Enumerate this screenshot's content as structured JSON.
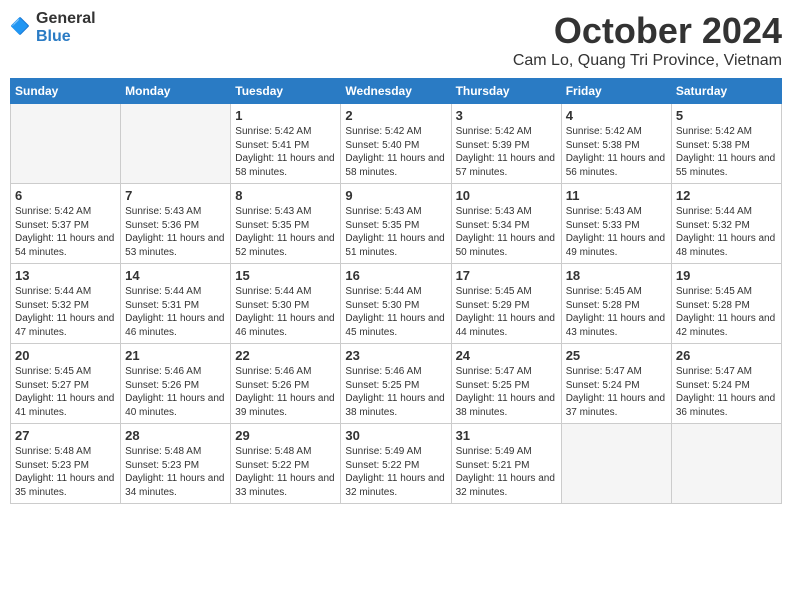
{
  "header": {
    "logo": {
      "general": "General",
      "blue": "Blue"
    },
    "title": "October 2024",
    "location": "Cam Lo, Quang Tri Province, Vietnam"
  },
  "calendar": {
    "days_of_week": [
      "Sunday",
      "Monday",
      "Tuesday",
      "Wednesday",
      "Thursday",
      "Friday",
      "Saturday"
    ],
    "weeks": [
      [
        {
          "day": "",
          "content": ""
        },
        {
          "day": "",
          "content": ""
        },
        {
          "day": "1",
          "content": "Sunrise: 5:42 AM\nSunset: 5:41 PM\nDaylight: 11 hours and 58 minutes."
        },
        {
          "day": "2",
          "content": "Sunrise: 5:42 AM\nSunset: 5:40 PM\nDaylight: 11 hours and 58 minutes."
        },
        {
          "day": "3",
          "content": "Sunrise: 5:42 AM\nSunset: 5:39 PM\nDaylight: 11 hours and 57 minutes."
        },
        {
          "day": "4",
          "content": "Sunrise: 5:42 AM\nSunset: 5:38 PM\nDaylight: 11 hours and 56 minutes."
        },
        {
          "day": "5",
          "content": "Sunrise: 5:42 AM\nSunset: 5:38 PM\nDaylight: 11 hours and 55 minutes."
        }
      ],
      [
        {
          "day": "6",
          "content": "Sunrise: 5:42 AM\nSunset: 5:37 PM\nDaylight: 11 hours and 54 minutes."
        },
        {
          "day": "7",
          "content": "Sunrise: 5:43 AM\nSunset: 5:36 PM\nDaylight: 11 hours and 53 minutes."
        },
        {
          "day": "8",
          "content": "Sunrise: 5:43 AM\nSunset: 5:35 PM\nDaylight: 11 hours and 52 minutes."
        },
        {
          "day": "9",
          "content": "Sunrise: 5:43 AM\nSunset: 5:35 PM\nDaylight: 11 hours and 51 minutes."
        },
        {
          "day": "10",
          "content": "Sunrise: 5:43 AM\nSunset: 5:34 PM\nDaylight: 11 hours and 50 minutes."
        },
        {
          "day": "11",
          "content": "Sunrise: 5:43 AM\nSunset: 5:33 PM\nDaylight: 11 hours and 49 minutes."
        },
        {
          "day": "12",
          "content": "Sunrise: 5:44 AM\nSunset: 5:32 PM\nDaylight: 11 hours and 48 minutes."
        }
      ],
      [
        {
          "day": "13",
          "content": "Sunrise: 5:44 AM\nSunset: 5:32 PM\nDaylight: 11 hours and 47 minutes."
        },
        {
          "day": "14",
          "content": "Sunrise: 5:44 AM\nSunset: 5:31 PM\nDaylight: 11 hours and 46 minutes."
        },
        {
          "day": "15",
          "content": "Sunrise: 5:44 AM\nSunset: 5:30 PM\nDaylight: 11 hours and 46 minutes."
        },
        {
          "day": "16",
          "content": "Sunrise: 5:44 AM\nSunset: 5:30 PM\nDaylight: 11 hours and 45 minutes."
        },
        {
          "day": "17",
          "content": "Sunrise: 5:45 AM\nSunset: 5:29 PM\nDaylight: 11 hours and 44 minutes."
        },
        {
          "day": "18",
          "content": "Sunrise: 5:45 AM\nSunset: 5:28 PM\nDaylight: 11 hours and 43 minutes."
        },
        {
          "day": "19",
          "content": "Sunrise: 5:45 AM\nSunset: 5:28 PM\nDaylight: 11 hours and 42 minutes."
        }
      ],
      [
        {
          "day": "20",
          "content": "Sunrise: 5:45 AM\nSunset: 5:27 PM\nDaylight: 11 hours and 41 minutes."
        },
        {
          "day": "21",
          "content": "Sunrise: 5:46 AM\nSunset: 5:26 PM\nDaylight: 11 hours and 40 minutes."
        },
        {
          "day": "22",
          "content": "Sunrise: 5:46 AM\nSunset: 5:26 PM\nDaylight: 11 hours and 39 minutes."
        },
        {
          "day": "23",
          "content": "Sunrise: 5:46 AM\nSunset: 5:25 PM\nDaylight: 11 hours and 38 minutes."
        },
        {
          "day": "24",
          "content": "Sunrise: 5:47 AM\nSunset: 5:25 PM\nDaylight: 11 hours and 38 minutes."
        },
        {
          "day": "25",
          "content": "Sunrise: 5:47 AM\nSunset: 5:24 PM\nDaylight: 11 hours and 37 minutes."
        },
        {
          "day": "26",
          "content": "Sunrise: 5:47 AM\nSunset: 5:24 PM\nDaylight: 11 hours and 36 minutes."
        }
      ],
      [
        {
          "day": "27",
          "content": "Sunrise: 5:48 AM\nSunset: 5:23 PM\nDaylight: 11 hours and 35 minutes."
        },
        {
          "day": "28",
          "content": "Sunrise: 5:48 AM\nSunset: 5:23 PM\nDaylight: 11 hours and 34 minutes."
        },
        {
          "day": "29",
          "content": "Sunrise: 5:48 AM\nSunset: 5:22 PM\nDaylight: 11 hours and 33 minutes."
        },
        {
          "day": "30",
          "content": "Sunrise: 5:49 AM\nSunset: 5:22 PM\nDaylight: 11 hours and 32 minutes."
        },
        {
          "day": "31",
          "content": "Sunrise: 5:49 AM\nSunset: 5:21 PM\nDaylight: 11 hours and 32 minutes."
        },
        {
          "day": "",
          "content": ""
        },
        {
          "day": "",
          "content": ""
        }
      ]
    ]
  }
}
